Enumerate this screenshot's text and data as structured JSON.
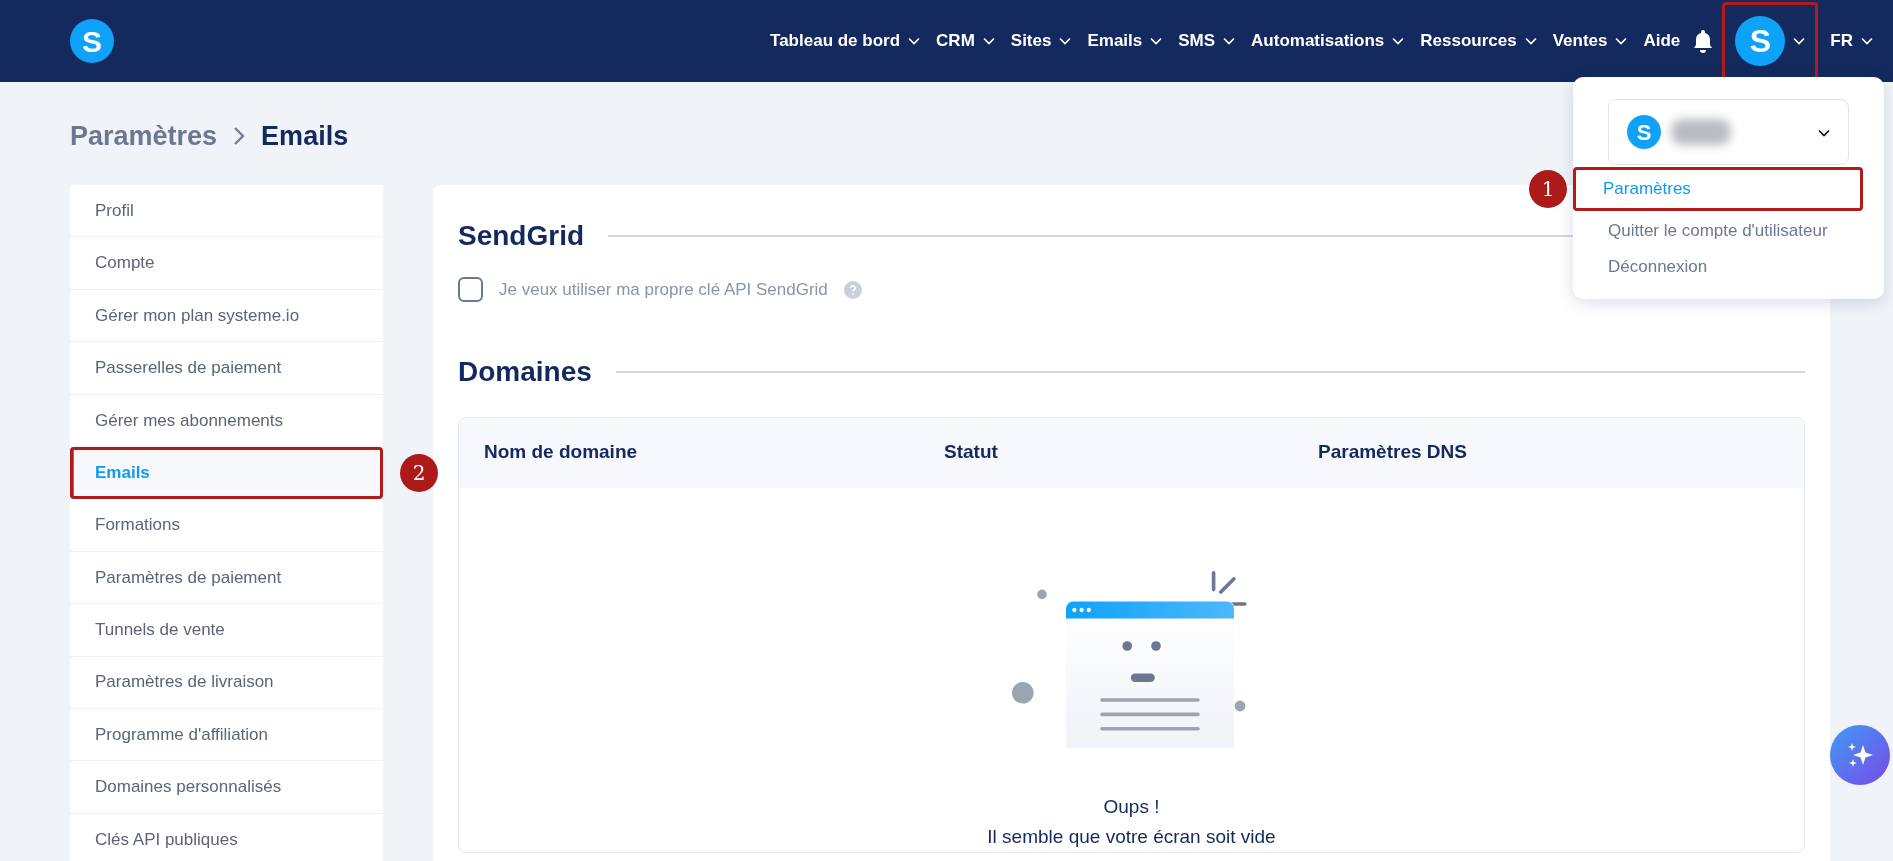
{
  "navbar": {
    "logo": "S",
    "items": [
      {
        "label": "Tableau de bord",
        "has_menu": true
      },
      {
        "label": "CRM",
        "has_menu": true
      },
      {
        "label": "Sites",
        "has_menu": true
      },
      {
        "label": "Emails",
        "has_menu": true
      },
      {
        "label": "SMS",
        "has_menu": true
      },
      {
        "label": "Automatisations",
        "has_menu": true
      },
      {
        "label": "Ressources",
        "has_menu": true
      },
      {
        "label": "Ventes",
        "has_menu": true
      },
      {
        "label": "Aide",
        "has_menu": false
      }
    ],
    "avatar": {
      "letter": "S",
      "highlighted": true
    },
    "language": "FR"
  },
  "breadcrumb": [
    "Paramètres",
    "Emails"
  ],
  "sidebar": {
    "items": [
      {
        "label": "Profil",
        "selected": false,
        "highlighted": false
      },
      {
        "label": "Compte",
        "selected": false,
        "highlighted": false
      },
      {
        "label": "Gérer mon plan systeme.io",
        "selected": false,
        "highlighted": false
      },
      {
        "label": "Passerelles de paiement",
        "selected": false,
        "highlighted": false
      },
      {
        "label": "Gérer mes abonnements",
        "selected": false,
        "highlighted": false
      },
      {
        "label": "Emails",
        "selected": true,
        "highlighted": true,
        "step": "2"
      },
      {
        "label": "Formations",
        "selected": false,
        "highlighted": false
      },
      {
        "label": "Paramètres de paiement",
        "selected": false,
        "highlighted": false
      },
      {
        "label": "Tunnels de vente",
        "selected": false,
        "highlighted": false
      },
      {
        "label": "Paramètres de livraison",
        "selected": false,
        "highlighted": false
      },
      {
        "label": "Programme d'affiliation",
        "selected": false,
        "highlighted": false
      },
      {
        "label": "Domaines personnalisés",
        "selected": false,
        "highlighted": false
      },
      {
        "label": "Clés API publiques",
        "selected": false,
        "highlighted": false
      }
    ]
  },
  "sendgrid": {
    "title": "SendGrid",
    "checkbox": {
      "label": "Je veux utiliser ma propre clé API SendGrid",
      "checked": false
    }
  },
  "domains": {
    "title": "Domaines",
    "columns": [
      "Nom de domaine",
      "Statut",
      "Paramètres DNS"
    ],
    "empty": {
      "title": "Oups !",
      "message": "Il semble que votre écran soit vide"
    }
  },
  "user_menu": {
    "account_letter": "S",
    "items": [
      {
        "label": "Paramètres",
        "selected": true,
        "highlighted": true,
        "step": "1"
      },
      {
        "label": "Quitter le compte d'utilisateur",
        "selected": false,
        "highlighted": false
      },
      {
        "label": "Déconnexion",
        "selected": false,
        "highlighted": false
      }
    ]
  }
}
